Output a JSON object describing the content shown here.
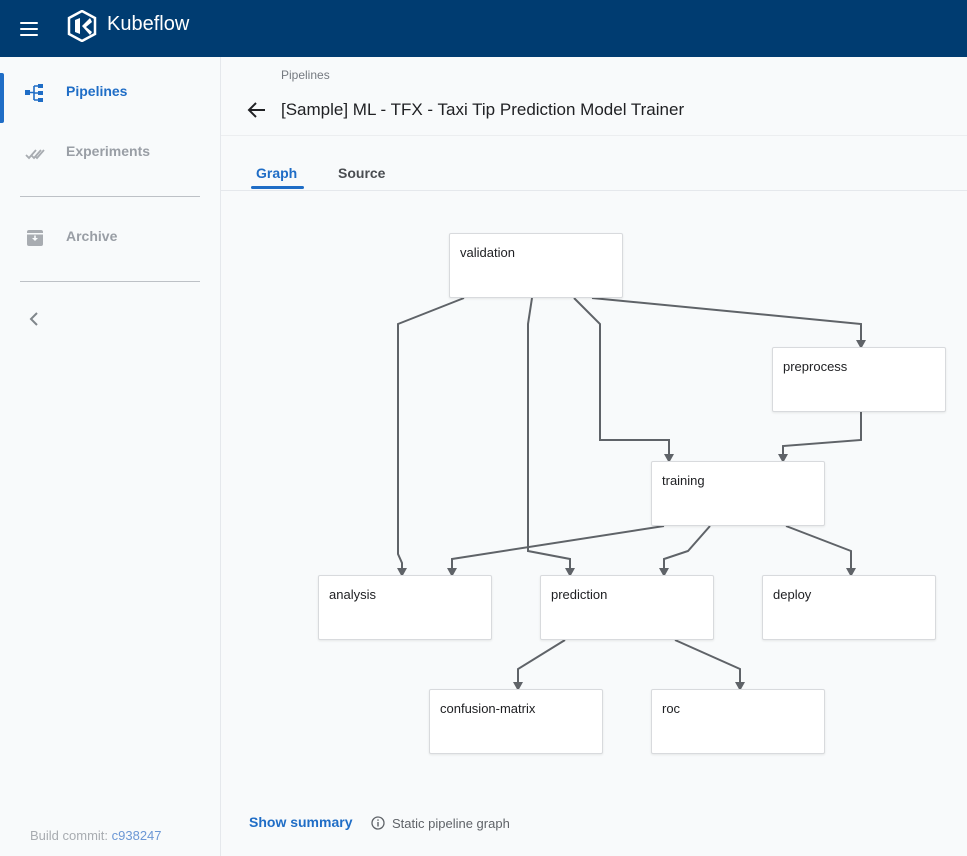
{
  "topbar": {
    "brand": "Kubeflow",
    "menu_icon": "hamburger-menu-icon",
    "logo_icon": "kubeflow-logo-icon"
  },
  "sidebar": {
    "items": [
      {
        "label": "Pipelines",
        "icon": "pipelines-icon",
        "active": true
      },
      {
        "label": "Experiments",
        "icon": "experiments-icon",
        "active": false
      },
      {
        "label": "Archive",
        "icon": "archive-icon",
        "active": false
      }
    ],
    "collapse_icon": "chevron-left-icon",
    "build_label": "Build commit: ",
    "build_commit": "c938247"
  },
  "header": {
    "breadcrumb": "Pipelines",
    "title": "[Sample] ML - TFX - Taxi Tip Prediction Model Trainer"
  },
  "tabs": [
    {
      "label": "Graph",
      "active": true
    },
    {
      "label": "Source",
      "active": false
    }
  ],
  "graph": {
    "nodes": [
      "validation",
      "preprocess",
      "training",
      "analysis",
      "prediction",
      "deploy",
      "confusion-matrix",
      "roc"
    ],
    "edges": [
      [
        "validation",
        "analysis"
      ],
      [
        "validation",
        "prediction"
      ],
      [
        "validation",
        "training"
      ],
      [
        "validation",
        "preprocess"
      ],
      [
        "preprocess",
        "training"
      ],
      [
        "training",
        "analysis"
      ],
      [
        "training",
        "prediction"
      ],
      [
        "training",
        "deploy"
      ],
      [
        "prediction",
        "confusion-matrix"
      ],
      [
        "prediction",
        "roc"
      ]
    ]
  },
  "footer": {
    "show_summary": "Show summary",
    "info_icon": "info-icon",
    "static_label": "Static pipeline graph"
  },
  "colors": {
    "topbar": "#003c71",
    "accent": "#1f6dc6",
    "edge": "#5f6368"
  }
}
